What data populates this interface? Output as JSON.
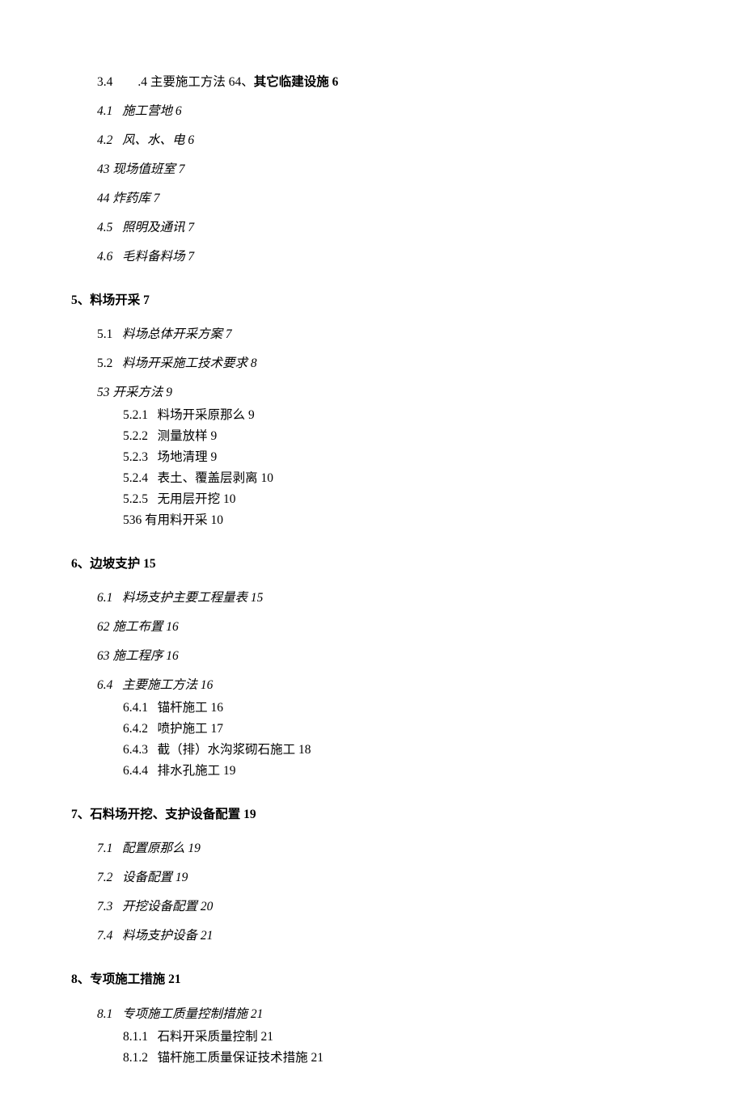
{
  "lines": {
    "head34": {
      "num": "3.4",
      "title": ".4 主要施工方法 64、",
      "tail": "其它临建设施 6"
    },
    "l41": {
      "num": "4.1",
      "title": "施工营地 6"
    },
    "l42": {
      "num": "4.2",
      "title": "风、水、电 6"
    },
    "l43": {
      "title": "43 现场值班室 7"
    },
    "l44": {
      "title": "44 炸药库 7"
    },
    "l45": {
      "num": "4.5",
      "title": "照明及通讯 7"
    },
    "l46": {
      "num": "4.6",
      "title": "毛料备料场 7"
    },
    "sec5": {
      "title": "5、料场开采 7"
    },
    "l51": {
      "num": "5.1",
      "title": "料场总体开采方案 7"
    },
    "l52": {
      "num": "5.2",
      "title": "料场开采施工技术要求 8"
    },
    "l53": {
      "title": "53 开采方法 9"
    },
    "l521": {
      "num": "5.2.1",
      "title": "料场开采原那么 9"
    },
    "l522": {
      "num": "5.2.2",
      "title": "测量放样 9"
    },
    "l523": {
      "num": "5.2.3",
      "title": "场地清理 9"
    },
    "l524": {
      "num": "5.2.4",
      "title": "表土、覆盖层剥离 10"
    },
    "l525": {
      "num": "5.2.5",
      "title": "无用层开挖 10"
    },
    "l536": {
      "title": "536 有用料开采 10"
    },
    "sec6": {
      "title": "6、边坡支护 15"
    },
    "l61": {
      "num": "6.1",
      "title": "料场支护主要工程量表 15"
    },
    "l62": {
      "title": "62 施工布置 16"
    },
    "l63": {
      "title": "63 施工程序 16"
    },
    "l64": {
      "num": "6.4",
      "title": "主要施工方法 16"
    },
    "l641": {
      "num": "6.4.1",
      "title": "锚杆施工 16"
    },
    "l642": {
      "num": "6.4.2",
      "title": "喷护施工 17"
    },
    "l643": {
      "num": "6.4.3",
      "title": "截（排）水沟浆砌石施工 18"
    },
    "l644": {
      "num": "6.4.4",
      "title": "排水孔施工 19"
    },
    "sec7": {
      "title": "7、石料场开挖、支护设备配置 19"
    },
    "l71": {
      "num": "7.1",
      "title": "配置原那么 19"
    },
    "l72": {
      "num": "7.2",
      "title": "设备配置 19"
    },
    "l73": {
      "num": "7.3",
      "title": "开挖设备配置 20"
    },
    "l74": {
      "num": "7.4",
      "title": "料场支护设备 21"
    },
    "sec8": {
      "title": "8、专项施工措施 21"
    },
    "l81": {
      "num": "8.1",
      "title": "专项施工质量控制措施 21"
    },
    "l811": {
      "num": "8.1.1",
      "title": "石料开采质量控制 21"
    },
    "l812": {
      "num": "8.1.2",
      "title": "锚杆施工质量保证技术措施 21"
    }
  }
}
